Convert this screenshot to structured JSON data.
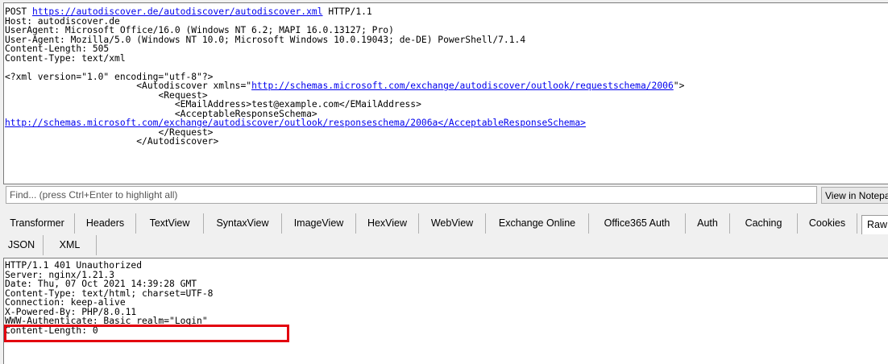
{
  "request": {
    "method": "POST",
    "url": "https://autodiscover.de/autodiscover/autodiscover.xml",
    "protocol": "HTTP/1.1",
    "headers": [
      "Host: autodiscover.de",
      "UserAgent: Microsoft Office/16.0 (Windows NT 6.2; MAPI 16.0.13127; Pro)",
      "User-Agent: Mozilla/5.0 (Windows NT 10.0; Microsoft Windows 10.0.19043; de-DE) PowerShell/7.1.4",
      "Content-Length: 505",
      "Content-Type: text/xml"
    ],
    "xml_decl": "<?xml version=\"1.0\" encoding=\"utf-8\"?>",
    "xml_autodiscover_open": "<Autodiscover xmlns=\"",
    "xml_ns_url": "http://schemas.microsoft.com/exchange/autodiscover/outlook/requestschema/2006",
    "xml_autodiscover_close_quote": "\">",
    "xml_request_open": "<Request>",
    "xml_email_open": "<EMailAddress>",
    "xml_email_value": "test@example.com",
    "xml_email_close": "</EMailAddress>",
    "xml_ars_open": "<AcceptableResponseSchema>",
    "xml_ars_value": "http://schemas.microsoft.com/exchange/autodiscover/outlook/responseschema/2006a",
    "xml_ars_close": "</AcceptableResponseSchema>",
    "xml_request_close": "</Request>",
    "xml_autodiscover_close": "</Autodiscover>"
  },
  "find": {
    "placeholder": "Find... (press Ctrl+Enter to highlight all)",
    "view_button": "View in Notepad"
  },
  "inspector_tabs": [
    "Transformer",
    "Headers",
    "TextView",
    "SyntaxView",
    "ImageView",
    "HexView",
    "WebView",
    "Exchange Online",
    "Office365 Auth",
    "Auth",
    "Caching",
    "Cookies",
    "Raw"
  ],
  "active_tab": "Raw",
  "sub_tabs": [
    "JSON",
    "XML"
  ],
  "response": {
    "lines": [
      "HTTP/1.1 401 Unauthorized",
      "Server: nginx/1.21.3",
      "Date: Thu, 07 Oct 2021 14:39:28 GMT",
      "Content-Type: text/html; charset=UTF-8",
      "Connection: keep-alive",
      "X-Powered-By: PHP/8.0.11",
      "WWW-Authenticate: Basic realm=\"Login\"",
      "Content-Length: 0"
    ]
  },
  "colors": {
    "link": "#0000ee",
    "highlight": "#e3000f"
  }
}
